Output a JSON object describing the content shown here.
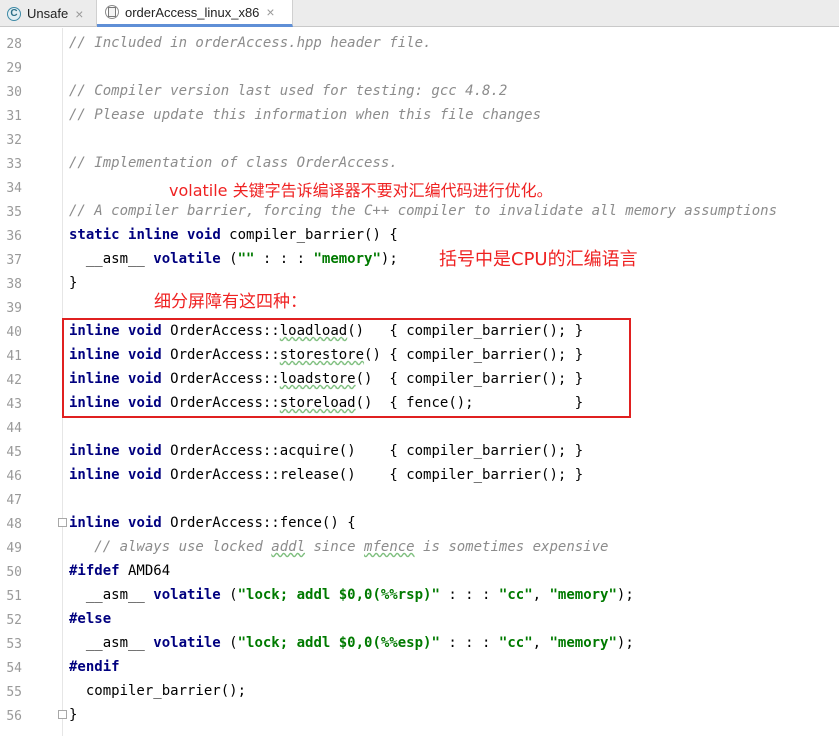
{
  "tabs": [
    {
      "label": "Unsafe",
      "icon": "c-class-icon",
      "letter": "C"
    },
    {
      "label": "orderAccess_linux_x86",
      "icon": "header-file-icon",
      "letter": "h"
    }
  ],
  "close_glyph": "×",
  "line_numbers": [
    "28",
    "29",
    "30",
    "31",
    "32",
    "33",
    "34",
    "35",
    "36",
    "37",
    "38",
    "39",
    "40",
    "41",
    "42",
    "43",
    "44",
    "45",
    "46",
    "47",
    "48",
    "49",
    "50",
    "51",
    "52",
    "53",
    "54",
    "55",
    "56"
  ],
  "code": {
    "l28": "// Included in orderAccess.hpp header file.",
    "l30": "// Compiler version last used for testing: gcc 4.8.2",
    "l31": "// Please update this information when this file changes",
    "l33": "// Implementation of class OrderAccess.",
    "l35": "// A compiler barrier, forcing the C++ compiler to invalidate all memory assumptions",
    "l36": {
      "kw1": "static",
      "kw2": "inline",
      "kw3": "void",
      "rest": " compiler_barrier() {"
    },
    "l37": {
      "pre": "  __asm__ ",
      "kw": "volatile",
      "mid": " (",
      "s1": "\"\"",
      "colons": " : : : ",
      "s2": "\"memory\"",
      "end": ");"
    },
    "l38": "}",
    "inline_kw": "inline",
    "void_kw": "void",
    "prefix": " OrderAccess::",
    "l40": {
      "name": "loadload",
      "rest": "()   { compiler_barrier(); }"
    },
    "l41": {
      "name": "storestore",
      "rest": "() { compiler_barrier(); }"
    },
    "l42": {
      "name": "loadstore",
      "rest": "()  { compiler_barrier(); }"
    },
    "l43": {
      "name": "storeload",
      "rest": "()  { fence();            }"
    },
    "l45": {
      "name": "acquire",
      "rest": "()    { compiler_barrier(); }"
    },
    "l46": {
      "name": "release",
      "rest": "()    { compiler_barrier(); }"
    },
    "l48": {
      "name": "fence",
      "rest": "() {"
    },
    "l49": {
      "a": "   // always use locked ",
      "b": "addl",
      "c": " since ",
      "d": "mfence",
      "e": " is sometimes expensive"
    },
    "l50": {
      "kw": "#ifdef",
      "rest": " AMD64"
    },
    "l51": {
      "pre": "  __asm__ ",
      "kw": "volatile",
      "mid": " (",
      "s1": "\"lock; addl $0,0(%%rsp)\"",
      "colons": " : : : ",
      "s2": "\"cc\"",
      "comma": ", ",
      "s3": "\"memory\"",
      "end": ");"
    },
    "l52": "#else",
    "l53": {
      "pre": "  __asm__ ",
      "kw": "volatile",
      "mid": " (",
      "s1": "\"lock; addl $0,0(%%esp)\"",
      "colons": " : : : ",
      "s2": "\"cc\"",
      "comma": ", ",
      "s3": "\"memory\"",
      "end": ");"
    },
    "l54": "#endif",
    "l55": "  compiler_barrier();",
    "l56": "}"
  },
  "annotations": {
    "volatile_note": "volatile 关键字告诉编译器不要对汇编代码进行优化。",
    "asm_note": "括号中是CPU的汇编语言",
    "barrier_note": "细分屏障有这四种："
  },
  "colors": {
    "comment": "#8c8c8c",
    "keyword": "#00007f",
    "string": "#007a00",
    "annotation": "#ef2222",
    "highlight_box": "#e02020",
    "active_tab_underline": "#5f8fd6"
  }
}
